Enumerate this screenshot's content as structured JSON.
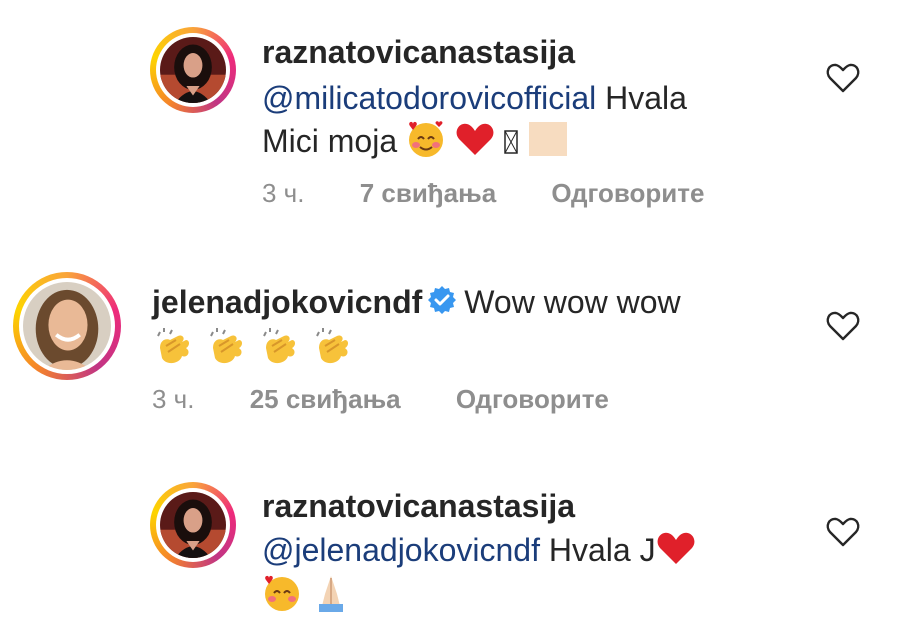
{
  "comments": [
    {
      "username": "raznatovicanastasija",
      "mention": "@milicatodorovicofficial",
      "text_line1_after_mention": " Hvala",
      "text_line2": "Mici moja",
      "time": "3 ч.",
      "likes": "7 свиђања",
      "reply": "Одговорите"
    },
    {
      "username": "jelenadjokovicndf",
      "text_line1": "Wow wow wow",
      "time": "3 ч.",
      "likes": "25 свиђања",
      "reply": "Одговорите"
    },
    {
      "username": "raznatovicanastasija",
      "mention": "@jelenadjokovicndf",
      "text_line1_after_mention": " Hvala J"
    }
  ],
  "colors": {
    "mention": "#1b3d7a",
    "meta": "#8e8e8e",
    "heart_red": "#e0202a",
    "verified_blue": "#3897f0"
  },
  "icons": [
    "heart-outline-icon",
    "verified-badge-icon",
    "red-heart-emoji",
    "smiling-face-hearts-emoji",
    "clapping-hands-emoji"
  ]
}
